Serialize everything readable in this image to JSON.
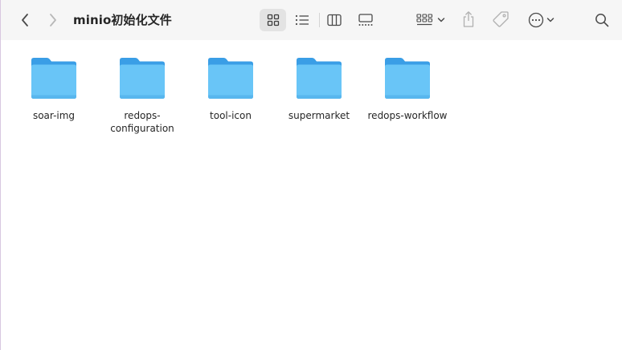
{
  "window": {
    "title": "minio初始化文件"
  },
  "toolbar": {
    "back_icon": "chevron-left-icon",
    "forward_icon": "chevron-right-icon",
    "views": [
      "icon-grid-view-icon",
      "list-view-icon",
      "column-view-icon",
      "gallery-view-icon"
    ],
    "selected_view": "icon-grid-view-icon",
    "group_icon": "group-by-icon",
    "share_icon": "share-icon",
    "tag_icon": "tag-icon",
    "more_icon": "ellipsis-circle-icon",
    "search_icon": "search-icon"
  },
  "folders": [
    {
      "name": "soar-img"
    },
    {
      "name": "redops-configuration"
    },
    {
      "name": "tool-icon"
    },
    {
      "name": "supermarket"
    },
    {
      "name": "redops-workflow"
    }
  ],
  "colors": {
    "folder_front": "#69c5f7",
    "folder_back": "#3a9ee6",
    "toolbar_bg": "#f6f6f6",
    "selected_view_bg": "#e3e3e3"
  }
}
